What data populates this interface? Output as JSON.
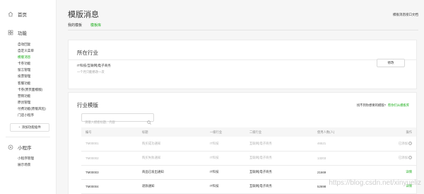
{
  "sidebar": {
    "home": "首页",
    "function": "功能",
    "items": [
      "自动回复",
      "自定义菜单",
      "模版消息",
      "卡券功能",
      "留言管理",
      "投票管理",
      "客服功能",
      "卡券(原页面模版)",
      "营销功能",
      "原创管理",
      "付费功能(原版风险)",
      "门店小程序"
    ],
    "active_index": 2,
    "add_plugin": "添加功能插件",
    "miniprogram": "小程序",
    "mini_items": [
      "小程序管理",
      "展示场景"
    ]
  },
  "header": {
    "title": "模版消息",
    "help": "模板消息接口文档"
  },
  "tabs": [
    "我的模板",
    "模板库"
  ],
  "active_tab": 1,
  "industry": {
    "heading": "所在行业",
    "value": "IT科技/互联网|电子商务",
    "note": "一个月只能修改一次",
    "modify": "修改"
  },
  "library": {
    "heading": "行业模版",
    "link_text": "找不到你想要的模版?",
    "link_action": "帮你们从模板库",
    "search_placeholder": "请输入模板标题、内容",
    "columns": [
      "编号",
      "标题",
      "一级行业",
      "二级行业",
      "使用人数(人)",
      "操作"
    ],
    "rows": [
      {
        "id": "TM00001",
        "title": "购买成功通知",
        "primary": "IT科技",
        "secondary": "互联网|电子商务",
        "users": "46521",
        "action": "已添加",
        "disabled": true
      },
      {
        "id": "TM00002",
        "title": "购买失败通知",
        "primary": "IT科技",
        "secondary": "互联网|电子商务",
        "users": "13203",
        "action": "已添加",
        "disabled": true
      },
      {
        "id": "TM00003",
        "title": "商品已发出通知",
        "primary": "IT科技",
        "secondary": "互联网|电子商务",
        "users": "21669",
        "action": "详情",
        "disabled": false
      },
      {
        "id": "TM00004",
        "title": "退款通知",
        "primary": "IT科技",
        "secondary": "互联网|电子商务",
        "users": "52698",
        "action": "详情",
        "disabled": false
      }
    ]
  },
  "watermark": "https://blog.csdn.net/xinyueliz",
  "colors": {
    "accent": "#1aad19",
    "muted": "#b2b2b2",
    "background": "#f6f6f6"
  },
  "icons": [
    "home-icon",
    "grid-icon",
    "plus-icon",
    "miniprogram-icon",
    "search-icon",
    "question-icon"
  ]
}
